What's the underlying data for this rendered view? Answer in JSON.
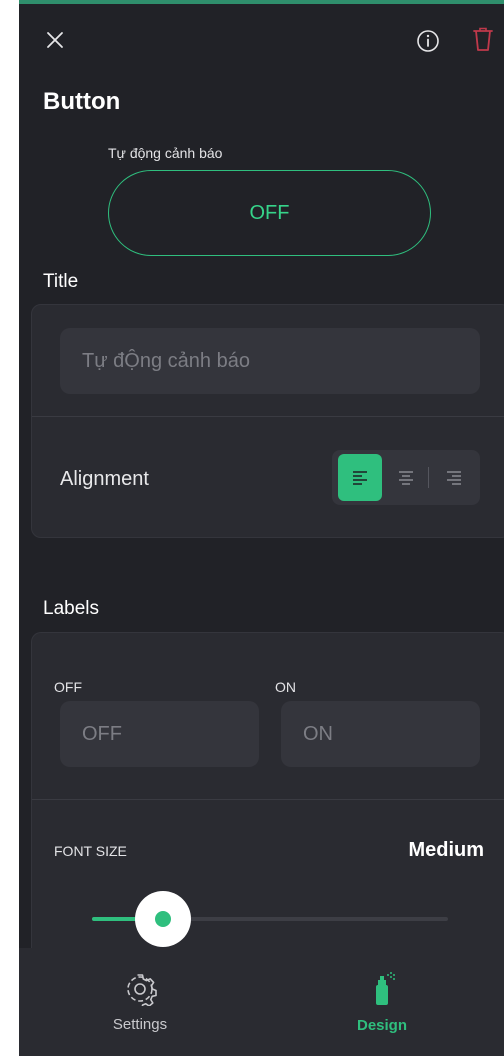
{
  "header": {
    "close_icon": "close-icon",
    "info_icon": "info-icon",
    "delete_icon": "trash-icon",
    "widget_title": "Button"
  },
  "preview": {
    "label": "Tự động cảnh báo",
    "button_text": "OFF"
  },
  "title_section": {
    "heading": "Title",
    "input_value": "Tự đỘng cảnh báo",
    "alignment_label": "Alignment",
    "alignment_options": [
      "align-left-icon",
      "align-center-icon",
      "align-right-icon"
    ],
    "alignment_selected": "left"
  },
  "labels_section": {
    "heading": "Labels",
    "off_label": "OFF",
    "off_value": "OFF",
    "on_label": "ON",
    "on_value": "ON",
    "font_size_label": "FONT SIZE",
    "font_size_value": "Medium",
    "font_size_level": 0.2
  },
  "bottom_nav": {
    "settings_label": "Settings",
    "design_label": "Design",
    "active": "Design"
  },
  "colors": {
    "accent": "#2fbf7e",
    "background": "#212227",
    "card": "#2a2b31",
    "danger": "#c0394b"
  }
}
